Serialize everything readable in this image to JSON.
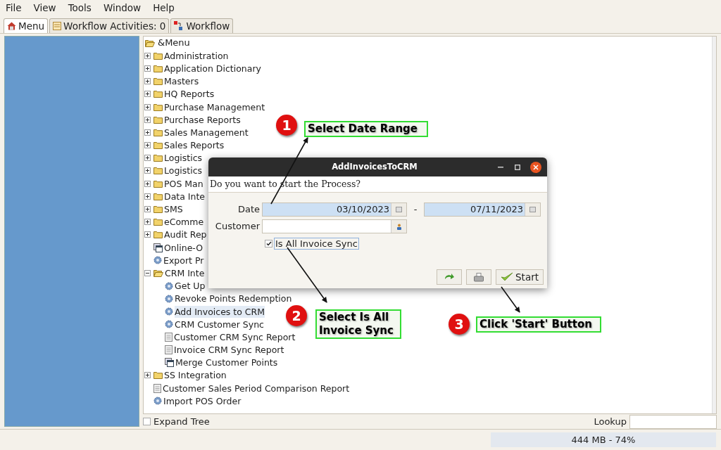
{
  "menu_bar": [
    "File",
    "View",
    "Tools",
    "Window",
    "Help"
  ],
  "tabs": [
    {
      "label": "Menu",
      "selected": true
    },
    {
      "label": "Workflow Activities: 0",
      "selected": false
    },
    {
      "label": "Workflow",
      "selected": false
    }
  ],
  "tree": {
    "label": "&Menu",
    "expanded": true,
    "children": [
      {
        "label": "Administration",
        "kind": "folder",
        "expanded": false
      },
      {
        "label": "Application Dictionary",
        "kind": "folder",
        "expanded": false
      },
      {
        "label": "Masters",
        "kind": "folder",
        "expanded": false
      },
      {
        "label": "HQ Reports",
        "kind": "folder",
        "expanded": false
      },
      {
        "label": "Purchase Management",
        "kind": "folder",
        "expanded": false
      },
      {
        "label": "Purchase Reports",
        "kind": "folder",
        "expanded": false
      },
      {
        "label": "Sales Management",
        "kind": "folder",
        "expanded": false
      },
      {
        "label": "Sales Reports",
        "kind": "folder",
        "expanded": false
      },
      {
        "label": "Logistics",
        "kind": "folder",
        "expanded": false
      },
      {
        "label": "Logistics",
        "kind": "folder",
        "expanded": false
      },
      {
        "label": "POS Man",
        "kind": "folder",
        "expanded": false
      },
      {
        "label": "Data Inte",
        "kind": "folder",
        "expanded": false
      },
      {
        "label": "SMS",
        "kind": "folder",
        "expanded": false
      },
      {
        "label": "eComme",
        "kind": "folder",
        "expanded": false
      },
      {
        "label": "Audit Rep",
        "kind": "folder",
        "expanded": false
      },
      {
        "label": "Online-O",
        "kind": "window",
        "selected": false
      },
      {
        "label": "Export Pr",
        "kind": "process",
        "selected": false
      },
      {
        "label": "CRM Inte",
        "kind": "folder",
        "expanded": true,
        "children": [
          {
            "label": "Get Up",
            "kind": "process",
            "selected": false
          },
          {
            "label": "Revoke Points Redemption",
            "kind": "process",
            "selected": false
          },
          {
            "label": "Add Invoices to CRM",
            "kind": "process",
            "selected": true
          },
          {
            "label": "CRM Customer Sync",
            "kind": "process",
            "selected": false
          },
          {
            "label": "Customer CRM Sync Report",
            "kind": "report",
            "selected": false
          },
          {
            "label": "Invoice CRM Sync Report",
            "kind": "report",
            "selected": false
          },
          {
            "label": "Merge Customer Points",
            "kind": "window",
            "selected": false
          }
        ]
      },
      {
        "label": "SS Integration",
        "kind": "folder",
        "expanded": false
      },
      {
        "label": "Customer Sales Period Comparison Report",
        "kind": "report",
        "selected": false
      },
      {
        "label": "Import POS Order",
        "kind": "process",
        "selected": false
      }
    ]
  },
  "expand_tree": {
    "label": "Expand Tree",
    "checked": false
  },
  "lookup": {
    "label": "Lookup"
  },
  "status_bar": {
    "memory": "444 MB - 74%"
  },
  "dialog": {
    "title": "AddInvoicesToCRM",
    "message": "Do you want to start the Process?",
    "date": {
      "label": "Date",
      "from": "03/10/2023",
      "separator": "-",
      "to": "07/11/2023"
    },
    "customer": {
      "label": "Customer"
    },
    "is_all_invoice_sync": {
      "label": "Is All Invoice Sync",
      "checked": true
    },
    "start_button": "Start"
  },
  "annotations": [
    {
      "number": "1",
      "text": "Select Date Range"
    },
    {
      "number": "2",
      "text": "Select Is All Invoice Sync"
    },
    {
      "number": "3",
      "text": "Click 'Start' Button"
    }
  ]
}
